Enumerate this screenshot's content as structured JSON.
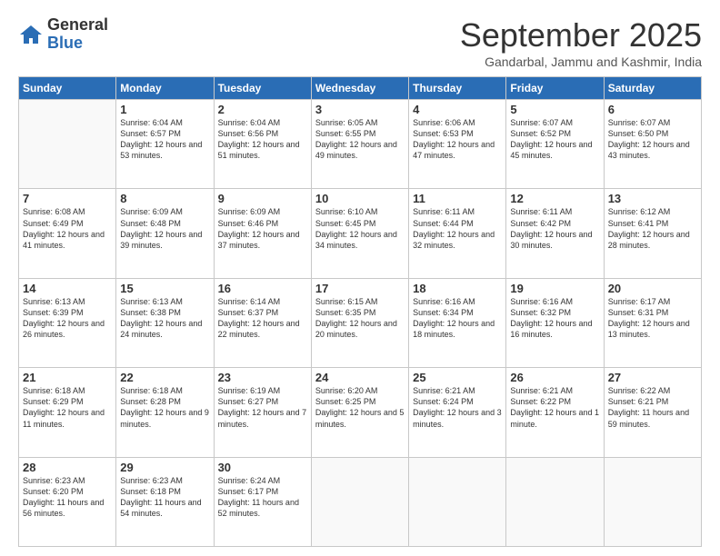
{
  "logo": {
    "general": "General",
    "blue": "Blue"
  },
  "header": {
    "month": "September 2025",
    "location": "Gandarbal, Jammu and Kashmir, India"
  },
  "weekdays": [
    "Sunday",
    "Monday",
    "Tuesday",
    "Wednesday",
    "Thursday",
    "Friday",
    "Saturday"
  ],
  "weeks": [
    [
      {
        "day": null,
        "sunrise": null,
        "sunset": null,
        "daylight": null
      },
      {
        "day": "1",
        "sunrise": "6:04 AM",
        "sunset": "6:57 PM",
        "daylight": "12 hours and 53 minutes."
      },
      {
        "day": "2",
        "sunrise": "6:04 AM",
        "sunset": "6:56 PM",
        "daylight": "12 hours and 51 minutes."
      },
      {
        "day": "3",
        "sunrise": "6:05 AM",
        "sunset": "6:55 PM",
        "daylight": "12 hours and 49 minutes."
      },
      {
        "day": "4",
        "sunrise": "6:06 AM",
        "sunset": "6:53 PM",
        "daylight": "12 hours and 47 minutes."
      },
      {
        "day": "5",
        "sunrise": "6:07 AM",
        "sunset": "6:52 PM",
        "daylight": "12 hours and 45 minutes."
      },
      {
        "day": "6",
        "sunrise": "6:07 AM",
        "sunset": "6:50 PM",
        "daylight": "12 hours and 43 minutes."
      }
    ],
    [
      {
        "day": "7",
        "sunrise": "6:08 AM",
        "sunset": "6:49 PM",
        "daylight": "12 hours and 41 minutes."
      },
      {
        "day": "8",
        "sunrise": "6:09 AM",
        "sunset": "6:48 PM",
        "daylight": "12 hours and 39 minutes."
      },
      {
        "day": "9",
        "sunrise": "6:09 AM",
        "sunset": "6:46 PM",
        "daylight": "12 hours and 37 minutes."
      },
      {
        "day": "10",
        "sunrise": "6:10 AM",
        "sunset": "6:45 PM",
        "daylight": "12 hours and 34 minutes."
      },
      {
        "day": "11",
        "sunrise": "6:11 AM",
        "sunset": "6:44 PM",
        "daylight": "12 hours and 32 minutes."
      },
      {
        "day": "12",
        "sunrise": "6:11 AM",
        "sunset": "6:42 PM",
        "daylight": "12 hours and 30 minutes."
      },
      {
        "day": "13",
        "sunrise": "6:12 AM",
        "sunset": "6:41 PM",
        "daylight": "12 hours and 28 minutes."
      }
    ],
    [
      {
        "day": "14",
        "sunrise": "6:13 AM",
        "sunset": "6:39 PM",
        "daylight": "12 hours and 26 minutes."
      },
      {
        "day": "15",
        "sunrise": "6:13 AM",
        "sunset": "6:38 PM",
        "daylight": "12 hours and 24 minutes."
      },
      {
        "day": "16",
        "sunrise": "6:14 AM",
        "sunset": "6:37 PM",
        "daylight": "12 hours and 22 minutes."
      },
      {
        "day": "17",
        "sunrise": "6:15 AM",
        "sunset": "6:35 PM",
        "daylight": "12 hours and 20 minutes."
      },
      {
        "day": "18",
        "sunrise": "6:16 AM",
        "sunset": "6:34 PM",
        "daylight": "12 hours and 18 minutes."
      },
      {
        "day": "19",
        "sunrise": "6:16 AM",
        "sunset": "6:32 PM",
        "daylight": "12 hours and 16 minutes."
      },
      {
        "day": "20",
        "sunrise": "6:17 AM",
        "sunset": "6:31 PM",
        "daylight": "12 hours and 13 minutes."
      }
    ],
    [
      {
        "day": "21",
        "sunrise": "6:18 AM",
        "sunset": "6:29 PM",
        "daylight": "12 hours and 11 minutes."
      },
      {
        "day": "22",
        "sunrise": "6:18 AM",
        "sunset": "6:28 PM",
        "daylight": "12 hours and 9 minutes."
      },
      {
        "day": "23",
        "sunrise": "6:19 AM",
        "sunset": "6:27 PM",
        "daylight": "12 hours and 7 minutes."
      },
      {
        "day": "24",
        "sunrise": "6:20 AM",
        "sunset": "6:25 PM",
        "daylight": "12 hours and 5 minutes."
      },
      {
        "day": "25",
        "sunrise": "6:21 AM",
        "sunset": "6:24 PM",
        "daylight": "12 hours and 3 minutes."
      },
      {
        "day": "26",
        "sunrise": "6:21 AM",
        "sunset": "6:22 PM",
        "daylight": "12 hours and 1 minute."
      },
      {
        "day": "27",
        "sunrise": "6:22 AM",
        "sunset": "6:21 PM",
        "daylight": "11 hours and 59 minutes."
      }
    ],
    [
      {
        "day": "28",
        "sunrise": "6:23 AM",
        "sunset": "6:20 PM",
        "daylight": "11 hours and 56 minutes."
      },
      {
        "day": "29",
        "sunrise": "6:23 AM",
        "sunset": "6:18 PM",
        "daylight": "11 hours and 54 minutes."
      },
      {
        "day": "30",
        "sunrise": "6:24 AM",
        "sunset": "6:17 PM",
        "daylight": "11 hours and 52 minutes."
      },
      {
        "day": null,
        "sunrise": null,
        "sunset": null,
        "daylight": null
      },
      {
        "day": null,
        "sunrise": null,
        "sunset": null,
        "daylight": null
      },
      {
        "day": null,
        "sunrise": null,
        "sunset": null,
        "daylight": null
      },
      {
        "day": null,
        "sunrise": null,
        "sunset": null,
        "daylight": null
      }
    ]
  ],
  "labels": {
    "sunrise": "Sunrise:",
    "sunset": "Sunset:",
    "daylight": "Daylight:"
  }
}
